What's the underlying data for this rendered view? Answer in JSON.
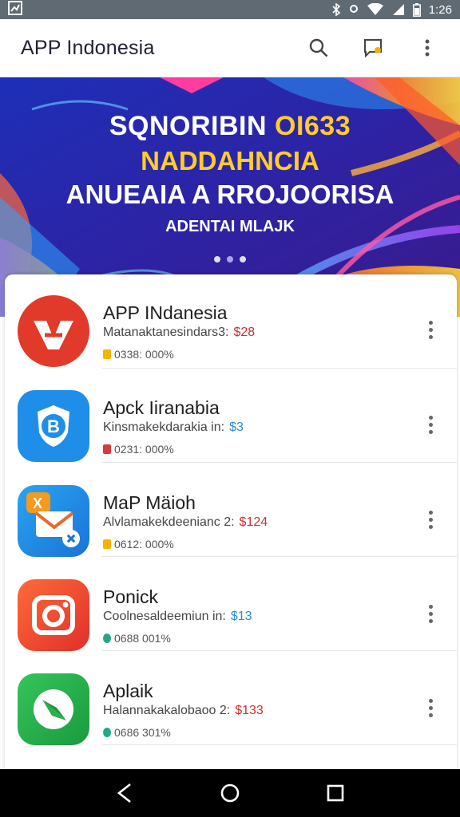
{
  "status_bar": {
    "time": "1:26",
    "icons": [
      "notification-icon",
      "bluetooth-icon",
      "location-icon",
      "wifi-icon",
      "signal-icon",
      "battery-icon"
    ]
  },
  "app_bar": {
    "title": "APP Indonesia",
    "actions": [
      "search-icon",
      "feedback-icon",
      "more-vertical-icon"
    ]
  },
  "banner": {
    "line1_white": "SQNORIBIN ",
    "line1_yellow": "OI633",
    "line2": "NADDAHNCIA",
    "line3": "ANUEAIA A RROJOORISA",
    "line4": "ADENTAI MLAJK",
    "active_slide": 1,
    "slides": 3,
    "colors": {
      "yellow": "#ffcc2a",
      "blue": "#2a2aa8"
    }
  },
  "apps": [
    {
      "name": "APP INdanesia",
      "desc": "Matanaktanesindars3:",
      "price": "$28",
      "price_color": "red",
      "meta": "0338: 000%",
      "badge_color": "#f5b400",
      "icon": "va-logo-icon"
    },
    {
      "name": "Apck Iiranabia",
      "desc": "Kinsmakekdarakia in:",
      "price": "$3",
      "price_color": "teal",
      "meta": "0231: 000%",
      "badge_color": "#d93a3a",
      "icon": "shield-b-icon"
    },
    {
      "name": "MaP Mäioh",
      "desc": "Alvlamakekdeenianc 2:",
      "price": "$124",
      "price_color": "red",
      "meta": "0612: 000%",
      "badge_color": "#f5b400",
      "icon": "mail-app-icon"
    },
    {
      "name": "Ponick",
      "desc": "Coolnesaldeemiun in:",
      "price": "$13",
      "price_color": "teal",
      "meta": "0688 001%",
      "badge_color": "#1fa98a",
      "icon": "camera-icon"
    },
    {
      "name": "Aplaik",
      "desc": "Halannakakalobaoo 2:",
      "price": "$133",
      "price_color": "red",
      "meta": "0686 301%",
      "badge_color": "#1fa98a",
      "icon": "compass-icon"
    }
  ],
  "nav_bar": [
    "back-icon",
    "home-icon",
    "recents-icon"
  ]
}
